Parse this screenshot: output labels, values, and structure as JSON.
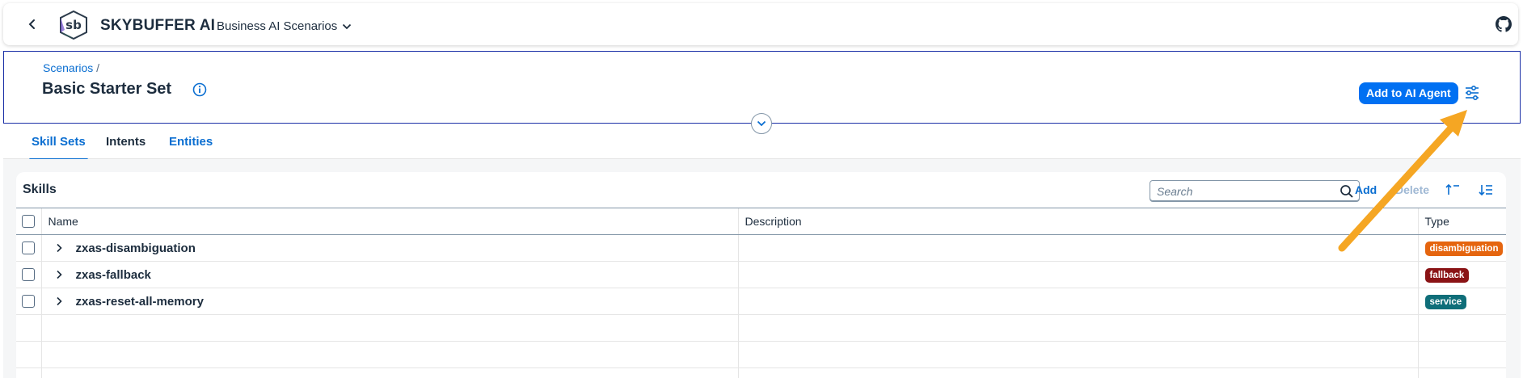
{
  "shell": {
    "brand": "SKYBUFFER AI",
    "product": "Business AI Scenarios",
    "logo_text": "sb"
  },
  "header": {
    "breadcrumb": "Scenarios",
    "breadcrumb_sep": "/",
    "title": "Basic Starter Set",
    "primary_button": "Add to AI Agent"
  },
  "tabs": [
    {
      "label": "Skill Sets"
    },
    {
      "label": "Intents"
    },
    {
      "label": "Entities"
    }
  ],
  "skills": {
    "title": "Skills",
    "search_placeholder": "Search",
    "add_label": "Add",
    "delete_label": "Delete",
    "columns": {
      "name": "Name",
      "description": "Description",
      "type": "Type"
    },
    "rows": [
      {
        "name": "zxas-disambiguation",
        "description": "",
        "type": "disambiguation",
        "type_color": "#e5650f"
      },
      {
        "name": "zxas-fallback",
        "description": "",
        "type": "fallback",
        "type_color": "#8a1315"
      },
      {
        "name": "zxas-reset-all-memory",
        "description": "",
        "type": "service",
        "type_color": "#0f6e79"
      }
    ]
  },
  "colors": {
    "accent": "#0070f2",
    "link": "#0a6ed1",
    "annotation_arrow": "#f5a623"
  }
}
